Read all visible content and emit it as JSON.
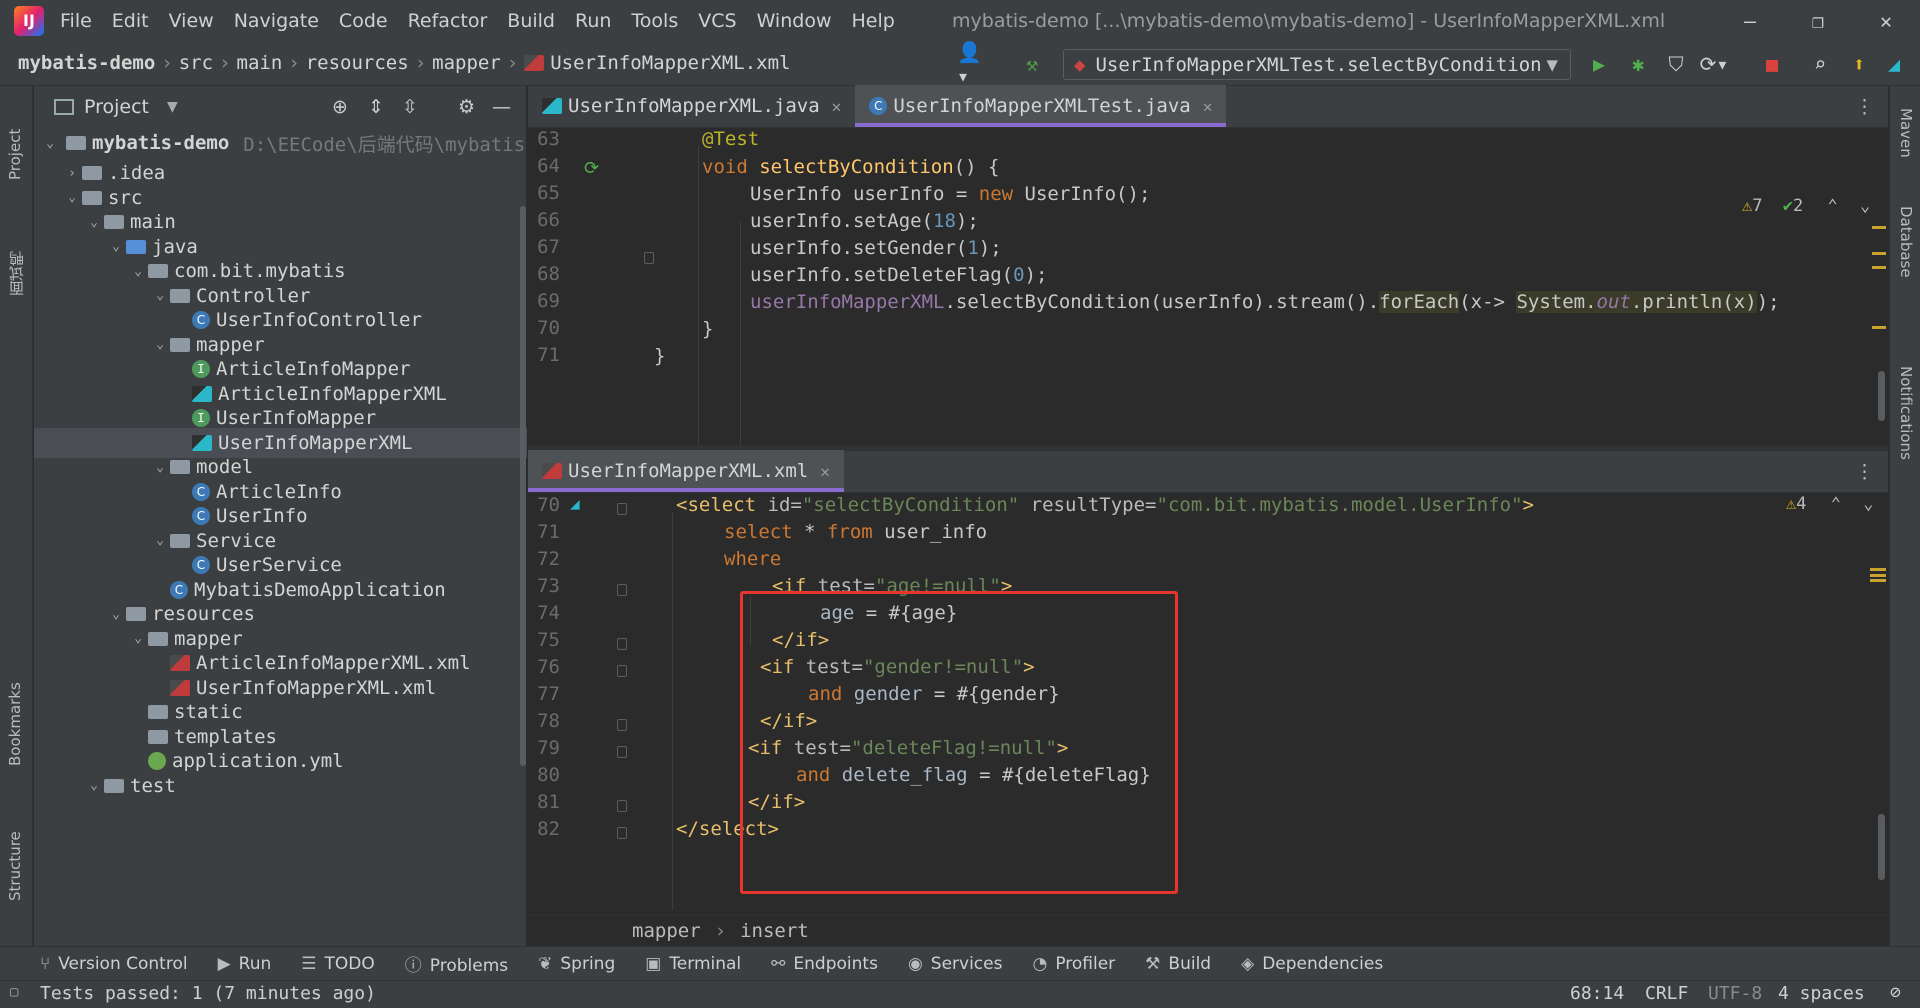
{
  "app": {
    "logo": "IJ",
    "menu": [
      "File",
      "Edit",
      "View",
      "Navigate",
      "Code",
      "Refactor",
      "Build",
      "Run",
      "Tools",
      "VCS",
      "Window",
      "Help"
    ],
    "title": "mybatis-demo [...\\mybatis-demo\\mybatis-demo] - UserInfoMapperXML.xml"
  },
  "breadcrumb": [
    "mybatis-demo",
    "src",
    "main",
    "resources",
    "mapper",
    "UserInfoMapperXML.xml"
  ],
  "toolbar": {
    "run_config": "UserInfoMapperXMLTest.selectByCondition"
  },
  "project": {
    "title": "Project",
    "root_label": "mybatis-demo",
    "root_path": "D:\\EECode\\后端代码\\mybatis",
    "items": [
      {
        "label": ".idea",
        "kind": "folder",
        "depth": 1,
        "arrow": "›"
      },
      {
        "label": "src",
        "kind": "folder",
        "depth": 1,
        "arrow": "⌄"
      },
      {
        "label": "main",
        "kind": "folder",
        "depth": 2,
        "arrow": "⌄"
      },
      {
        "label": "java",
        "kind": "folder-blue",
        "depth": 3,
        "arrow": "⌄"
      },
      {
        "label": "com.bit.mybatis",
        "kind": "folder",
        "depth": 4,
        "arrow": "⌄"
      },
      {
        "label": "Controller",
        "kind": "folder",
        "depth": 5,
        "arrow": "⌄"
      },
      {
        "label": "UserInfoController",
        "kind": "class",
        "depth": 6,
        "arrow": ""
      },
      {
        "label": "mapper",
        "kind": "folder",
        "depth": 5,
        "arrow": "⌄"
      },
      {
        "label": "ArticleInfoMapper",
        "kind": "interface",
        "depth": 6,
        "arrow": ""
      },
      {
        "label": "ArticleInfoMapperXML",
        "kind": "mybatis",
        "depth": 6,
        "arrow": ""
      },
      {
        "label": "UserInfoMapper",
        "kind": "interface",
        "depth": 6,
        "arrow": ""
      },
      {
        "label": "UserInfoMapperXML",
        "kind": "mybatis",
        "depth": 6,
        "arrow": "",
        "selected": true
      },
      {
        "label": "model",
        "kind": "folder",
        "depth": 5,
        "arrow": "⌄"
      },
      {
        "label": "ArticleInfo",
        "kind": "class",
        "depth": 6,
        "arrow": ""
      },
      {
        "label": "UserInfo",
        "kind": "class",
        "depth": 6,
        "arrow": ""
      },
      {
        "label": "Service",
        "kind": "folder",
        "depth": 5,
        "arrow": "⌄"
      },
      {
        "label": "UserService",
        "kind": "class",
        "depth": 6,
        "arrow": ""
      },
      {
        "label": "MybatisDemoApplication",
        "kind": "class",
        "depth": 5,
        "arrow": ""
      },
      {
        "label": "resources",
        "kind": "folder",
        "depth": 3,
        "arrow": "⌄"
      },
      {
        "label": "mapper",
        "kind": "folder",
        "depth": 4,
        "arrow": "⌄"
      },
      {
        "label": "ArticleInfoMapperXML.xml",
        "kind": "xml",
        "depth": 5,
        "arrow": ""
      },
      {
        "label": "UserInfoMapperXML.xml",
        "kind": "xml",
        "depth": 5,
        "arrow": ""
      },
      {
        "label": "static",
        "kind": "folder",
        "depth": 4,
        "arrow": ""
      },
      {
        "label": "templates",
        "kind": "folder",
        "depth": 4,
        "arrow": ""
      },
      {
        "label": "application.yml",
        "kind": "yml",
        "depth": 4,
        "arrow": ""
      },
      {
        "label": "test",
        "kind": "folder",
        "depth": 2,
        "arrow": "⌄"
      }
    ]
  },
  "left_strip": [
    "Project",
    "面试鸭",
    "Bookmarks",
    "Structure"
  ],
  "right_strip": [
    "Maven",
    "Database",
    "Notifications"
  ],
  "top_editor": {
    "tabs": [
      {
        "label": "UserInfoMapperXML.java",
        "active": false
      },
      {
        "label": "UserInfoMapperXMLTest.java",
        "active": true
      }
    ],
    "warnings": "7",
    "checks": "2",
    "lines": [
      63,
      64,
      65,
      66,
      67,
      68,
      69,
      70,
      71
    ]
  },
  "bottom_editor": {
    "tabs": [
      {
        "label": "UserInfoMapperXML.xml",
        "active": true
      }
    ],
    "warnings": "4",
    "lines": [
      70,
      71,
      72,
      73,
      74,
      75,
      76,
      77,
      78,
      79,
      80,
      81,
      82
    ],
    "breadcrumb": [
      "mapper",
      "insert"
    ]
  },
  "tool_windows": [
    "Version Control",
    "Run",
    "TODO",
    "Problems",
    "Spring",
    "Terminal",
    "Endpoints",
    "Services",
    "Profiler",
    "Build",
    "Dependencies"
  ],
  "status": {
    "message": "Tests passed: 1 (7 minutes ago)",
    "position": "68:14",
    "line_sep": "CRLF",
    "encoding": "UTF-8",
    "indent": "4 spaces"
  },
  "colors": {
    "accent": "#8a6cd1",
    "highlight_box": "#e8352d",
    "bg": "#2b2b2b",
    "panel": "#3c3f41"
  }
}
